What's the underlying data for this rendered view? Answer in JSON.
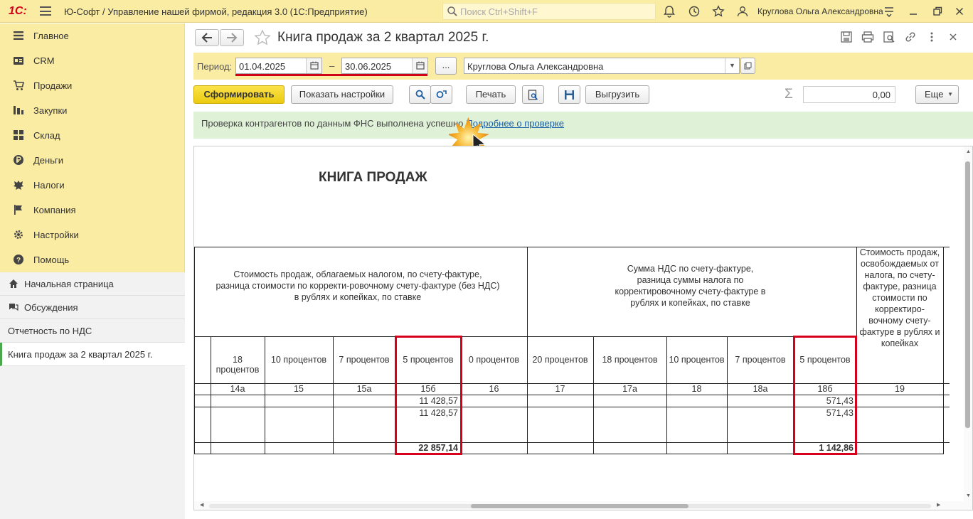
{
  "titlebar": {
    "logo": "1С:",
    "app_title": "Ю-Софт / Управление нашей фирмой, редакция 3.0  (1С:Предприятие)",
    "search_placeholder": "Поиск Ctrl+Shift+F",
    "user": "Круглова Ольга Александровна"
  },
  "sidebar": {
    "menu": [
      {
        "label": "Главное",
        "icon": "menu-icon"
      },
      {
        "label": "CRM",
        "icon": "crm-icon"
      },
      {
        "label": "Продажи",
        "icon": "cart-icon"
      },
      {
        "label": "Закупки",
        "icon": "purchases-icon"
      },
      {
        "label": "Склад",
        "icon": "warehouse-icon"
      },
      {
        "label": "Деньги",
        "icon": "ruble-icon"
      },
      {
        "label": "Налоги",
        "icon": "emblem-icon"
      },
      {
        "label": "Компания",
        "icon": "flag-icon"
      },
      {
        "label": "Настройки",
        "icon": "gear-icon"
      },
      {
        "label": "Помощь",
        "icon": "help-icon"
      }
    ],
    "nav": [
      {
        "label": "Начальная страница",
        "icon": "home-icon"
      },
      {
        "label": "Обсуждения",
        "icon": "chat-icon"
      },
      {
        "label": "Отчетность по НДС"
      },
      {
        "label": "Книга продаж за 2 квартал 2025 г."
      }
    ]
  },
  "header": {
    "title": "Книга продаж за 2 квартал 2025 г."
  },
  "period": {
    "label": "Период:",
    "from": "01.04.2025",
    "dash": "–",
    "to": "30.06.2025",
    "more": "...",
    "organization": "Круглова Ольга Александровна"
  },
  "toolbar": {
    "generate": "Сформировать",
    "show_settings": "Показать настройки",
    "print": "Печать",
    "export": "Выгрузить",
    "sum_symbol": "Σ",
    "sum_value": "0,00",
    "more": "Еще"
  },
  "notice": {
    "text": "Проверка контрагентов по данным ФНС выполнена успешно",
    "link": "Подробнее о проверке"
  },
  "report": {
    "title": "КНИГА ПРОДАЖ",
    "group1": "Стоимость продаж, облагаемых налогом, по счету-фактуре, разница стоимости по корректи-ровочному счету-фактуре (без НДС) в рублях и копейках, по ставке",
    "group2": "Сумма НДС по счету-фактуре, разница суммы налога по корректировочному счету-фактуре в рублях и копейках, по ставке",
    "group3": "Стоимость продаж, освобождаемых от налога, по счету-фактуре, разница стоимости по корректиро-вочному счету-фактуре в рублях и копейках",
    "columns": [
      {
        "label": "18 процентов",
        "code": "14а"
      },
      {
        "label": "10 процентов",
        "code": "15"
      },
      {
        "label": "7 процентов",
        "code": "15а"
      },
      {
        "label": "5 процентов",
        "code": "15б"
      },
      {
        "label": "0 процентов",
        "code": "16"
      },
      {
        "label": "20 процентов",
        "code": "17"
      },
      {
        "label": "18 процентов",
        "code": "17а"
      },
      {
        "label": "10 процентов",
        "code": "18"
      },
      {
        "label": "7 процентов",
        "code": "18а"
      },
      {
        "label": "5 процентов",
        "code": "18б"
      },
      {
        "label": "",
        "code": "19"
      }
    ],
    "rows": [
      {
        "c15b": "11 428,57",
        "c18b": "571,43"
      },
      {
        "c15b": "11 428,57",
        "c18b": "571,43"
      }
    ],
    "totals": {
      "c15b": "22 857,14",
      "c18b": "1 142,86"
    }
  },
  "colors": {
    "accent_yellow": "#fbeca4",
    "primary_button": "#f2d527",
    "highlight_red": "#d6001c",
    "notice_green": "#dff1d6"
  }
}
